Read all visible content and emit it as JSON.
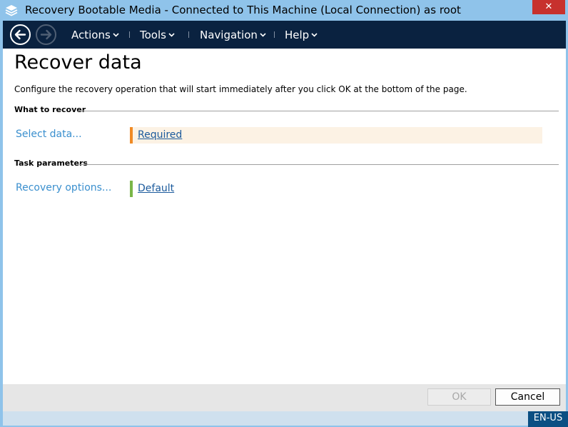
{
  "window": {
    "title": "Recovery Bootable Media - Connected to This Machine (Local Connection) as root",
    "close_glyph": "✕",
    "app_icon": "layers-icon"
  },
  "menubar": {
    "back_icon": "back-arrow-icon",
    "forward_icon": "forward-arrow-icon",
    "items": [
      {
        "label": "Actions"
      },
      {
        "label": "Tools"
      },
      {
        "label": "Navigation"
      },
      {
        "label": "Help"
      }
    ]
  },
  "page": {
    "title": "Recover data",
    "description": "Configure the recovery operation that will start immediately after you click OK at the bottom of the page."
  },
  "sections": [
    {
      "title": "What to recover",
      "rows": [
        {
          "label": "Select data...",
          "value": "Required",
          "status_color": "#f08a24",
          "row_bg": "#fcf2e4"
        }
      ]
    },
    {
      "title": "Task parameters",
      "rows": [
        {
          "label": "Recovery options...",
          "value": "Default",
          "status_color": "#7ab648",
          "row_bg": "#ffffff"
        }
      ]
    }
  ],
  "footer": {
    "ok_label": "OK",
    "ok_enabled": false,
    "cancel_label": "Cancel"
  },
  "statusbar": {
    "language": "EN-US"
  },
  "colors": {
    "menubar_bg": "#0a2240",
    "titlebar_bg": "#8fc3ea",
    "link_color": "#3a8fce"
  }
}
